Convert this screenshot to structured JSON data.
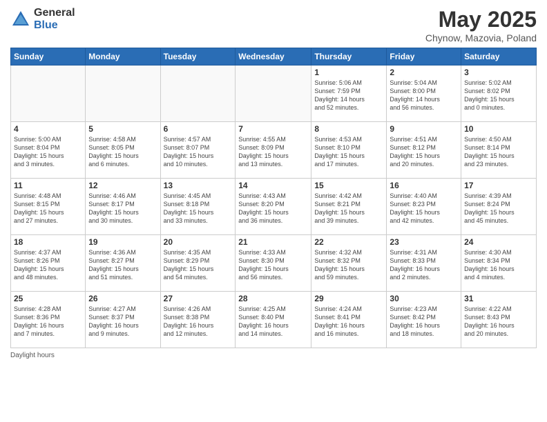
{
  "header": {
    "logo_general": "General",
    "logo_blue": "Blue",
    "title": "May 2025",
    "location": "Chynow, Mazovia, Poland"
  },
  "days_of_week": [
    "Sunday",
    "Monday",
    "Tuesday",
    "Wednesday",
    "Thursday",
    "Friday",
    "Saturday"
  ],
  "footer_text": "Daylight hours",
  "weeks": [
    [
      {
        "day": "",
        "info": ""
      },
      {
        "day": "",
        "info": ""
      },
      {
        "day": "",
        "info": ""
      },
      {
        "day": "",
        "info": ""
      },
      {
        "day": "1",
        "info": "Sunrise: 5:06 AM\nSunset: 7:59 PM\nDaylight: 14 hours\nand 52 minutes."
      },
      {
        "day": "2",
        "info": "Sunrise: 5:04 AM\nSunset: 8:00 PM\nDaylight: 14 hours\nand 56 minutes."
      },
      {
        "day": "3",
        "info": "Sunrise: 5:02 AM\nSunset: 8:02 PM\nDaylight: 15 hours\nand 0 minutes."
      }
    ],
    [
      {
        "day": "4",
        "info": "Sunrise: 5:00 AM\nSunset: 8:04 PM\nDaylight: 15 hours\nand 3 minutes."
      },
      {
        "day": "5",
        "info": "Sunrise: 4:58 AM\nSunset: 8:05 PM\nDaylight: 15 hours\nand 6 minutes."
      },
      {
        "day": "6",
        "info": "Sunrise: 4:57 AM\nSunset: 8:07 PM\nDaylight: 15 hours\nand 10 minutes."
      },
      {
        "day": "7",
        "info": "Sunrise: 4:55 AM\nSunset: 8:09 PM\nDaylight: 15 hours\nand 13 minutes."
      },
      {
        "day": "8",
        "info": "Sunrise: 4:53 AM\nSunset: 8:10 PM\nDaylight: 15 hours\nand 17 minutes."
      },
      {
        "day": "9",
        "info": "Sunrise: 4:51 AM\nSunset: 8:12 PM\nDaylight: 15 hours\nand 20 minutes."
      },
      {
        "day": "10",
        "info": "Sunrise: 4:50 AM\nSunset: 8:14 PM\nDaylight: 15 hours\nand 23 minutes."
      }
    ],
    [
      {
        "day": "11",
        "info": "Sunrise: 4:48 AM\nSunset: 8:15 PM\nDaylight: 15 hours\nand 27 minutes."
      },
      {
        "day": "12",
        "info": "Sunrise: 4:46 AM\nSunset: 8:17 PM\nDaylight: 15 hours\nand 30 minutes."
      },
      {
        "day": "13",
        "info": "Sunrise: 4:45 AM\nSunset: 8:18 PM\nDaylight: 15 hours\nand 33 minutes."
      },
      {
        "day": "14",
        "info": "Sunrise: 4:43 AM\nSunset: 8:20 PM\nDaylight: 15 hours\nand 36 minutes."
      },
      {
        "day": "15",
        "info": "Sunrise: 4:42 AM\nSunset: 8:21 PM\nDaylight: 15 hours\nand 39 minutes."
      },
      {
        "day": "16",
        "info": "Sunrise: 4:40 AM\nSunset: 8:23 PM\nDaylight: 15 hours\nand 42 minutes."
      },
      {
        "day": "17",
        "info": "Sunrise: 4:39 AM\nSunset: 8:24 PM\nDaylight: 15 hours\nand 45 minutes."
      }
    ],
    [
      {
        "day": "18",
        "info": "Sunrise: 4:37 AM\nSunset: 8:26 PM\nDaylight: 15 hours\nand 48 minutes."
      },
      {
        "day": "19",
        "info": "Sunrise: 4:36 AM\nSunset: 8:27 PM\nDaylight: 15 hours\nand 51 minutes."
      },
      {
        "day": "20",
        "info": "Sunrise: 4:35 AM\nSunset: 8:29 PM\nDaylight: 15 hours\nand 54 minutes."
      },
      {
        "day": "21",
        "info": "Sunrise: 4:33 AM\nSunset: 8:30 PM\nDaylight: 15 hours\nand 56 minutes."
      },
      {
        "day": "22",
        "info": "Sunrise: 4:32 AM\nSunset: 8:32 PM\nDaylight: 15 hours\nand 59 minutes."
      },
      {
        "day": "23",
        "info": "Sunrise: 4:31 AM\nSunset: 8:33 PM\nDaylight: 16 hours\nand 2 minutes."
      },
      {
        "day": "24",
        "info": "Sunrise: 4:30 AM\nSunset: 8:34 PM\nDaylight: 16 hours\nand 4 minutes."
      }
    ],
    [
      {
        "day": "25",
        "info": "Sunrise: 4:28 AM\nSunset: 8:36 PM\nDaylight: 16 hours\nand 7 minutes."
      },
      {
        "day": "26",
        "info": "Sunrise: 4:27 AM\nSunset: 8:37 PM\nDaylight: 16 hours\nand 9 minutes."
      },
      {
        "day": "27",
        "info": "Sunrise: 4:26 AM\nSunset: 8:38 PM\nDaylight: 16 hours\nand 12 minutes."
      },
      {
        "day": "28",
        "info": "Sunrise: 4:25 AM\nSunset: 8:40 PM\nDaylight: 16 hours\nand 14 minutes."
      },
      {
        "day": "29",
        "info": "Sunrise: 4:24 AM\nSunset: 8:41 PM\nDaylight: 16 hours\nand 16 minutes."
      },
      {
        "day": "30",
        "info": "Sunrise: 4:23 AM\nSunset: 8:42 PM\nDaylight: 16 hours\nand 18 minutes."
      },
      {
        "day": "31",
        "info": "Sunrise: 4:22 AM\nSunset: 8:43 PM\nDaylight: 16 hours\nand 20 minutes."
      }
    ]
  ]
}
